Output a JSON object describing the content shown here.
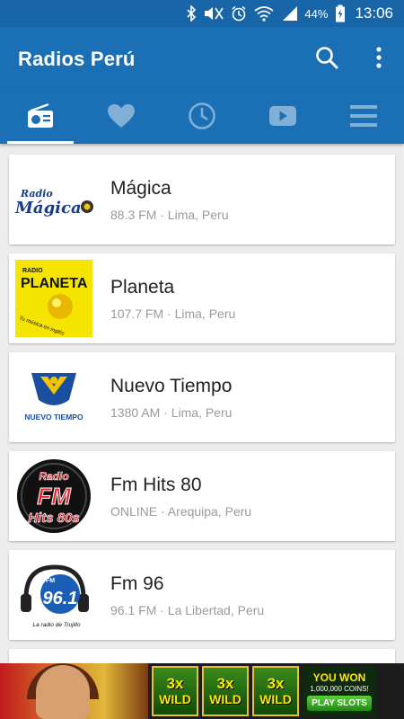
{
  "status_bar": {
    "battery_percent": "44%",
    "time": "13:06",
    "icons": [
      "bluetooth-icon",
      "mute-icon",
      "alarm-icon",
      "wifi-icon",
      "signal-icon",
      "battery-charging-icon"
    ]
  },
  "app_bar": {
    "title": "Radios Perú",
    "actions": [
      "search-icon",
      "more-vert-icon"
    ]
  },
  "tabs": [
    {
      "icon": "radio-icon",
      "active": true
    },
    {
      "icon": "heart-icon",
      "active": false
    },
    {
      "icon": "clock-icon",
      "active": false
    },
    {
      "icon": "video-icon",
      "active": false
    },
    {
      "icon": "menu-icon",
      "active": false
    }
  ],
  "stations": [
    {
      "name": "Mágica",
      "subtitle": "88.3 FM · Lima, Peru",
      "logo_text": [
        "Radio",
        "Mágica"
      ]
    },
    {
      "name": "Planeta",
      "subtitle": "107.7 FM · Lima, Peru",
      "logo_text": [
        "RADIO",
        "PLANETA",
        "Tu música en inglés"
      ]
    },
    {
      "name": "Nuevo Tiempo",
      "subtitle": "1380 AM · Lima, Peru",
      "logo_text": [
        "NUEVO TIEMPO"
      ]
    },
    {
      "name": "Fm Hits 80",
      "subtitle": "ONLINE · Arequipa, Peru",
      "logo_text": [
        "Radio",
        "FM",
        "Hits 80s"
      ]
    },
    {
      "name": "Fm 96",
      "subtitle": "96.1 FM · La Libertad, Peru",
      "logo_text": [
        "FM",
        "96.1",
        "La radio de Trujillo"
      ]
    }
  ],
  "ad": {
    "reels": [
      {
        "line1": "3x",
        "line2": "WILD"
      },
      {
        "line1": "3x",
        "line2": "WILD"
      },
      {
        "line1": "3x",
        "line2": "WILD"
      }
    ],
    "won_title": "YOU WON",
    "won_amount": "1,000,000 COINS!",
    "cta": "PLAY SLOTS"
  },
  "colors": {
    "primary": "#1a6fb5",
    "status_bar": "#1866a8",
    "background": "#ececec",
    "subtitle": "#9a9a9a"
  }
}
